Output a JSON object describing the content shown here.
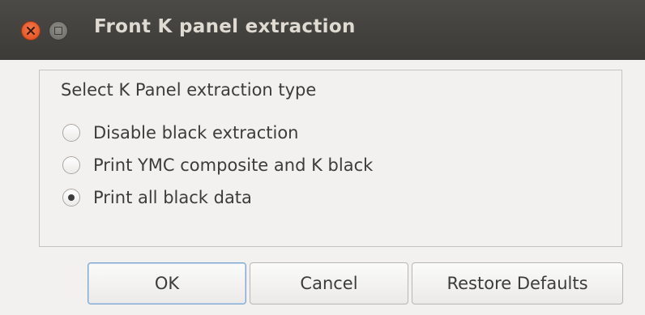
{
  "window": {
    "title": "Front K panel extraction"
  },
  "group": {
    "label": "Select K Panel extraction type",
    "options": [
      {
        "label": "Disable black extraction",
        "checked": false
      },
      {
        "label": "Print YMC composite and K black",
        "checked": false
      },
      {
        "label": "Print all black data",
        "checked": true
      }
    ]
  },
  "buttons": {
    "ok": "OK",
    "cancel": "Cancel",
    "restore": "Restore Defaults"
  },
  "icons": {
    "close": "close-icon",
    "minimize": "minimize-icon",
    "radio": "radio-icon"
  },
  "colors": {
    "titlebar": "#3c3b37",
    "close_button": "#df4a16",
    "default_button_border": "#7ea6cf"
  }
}
